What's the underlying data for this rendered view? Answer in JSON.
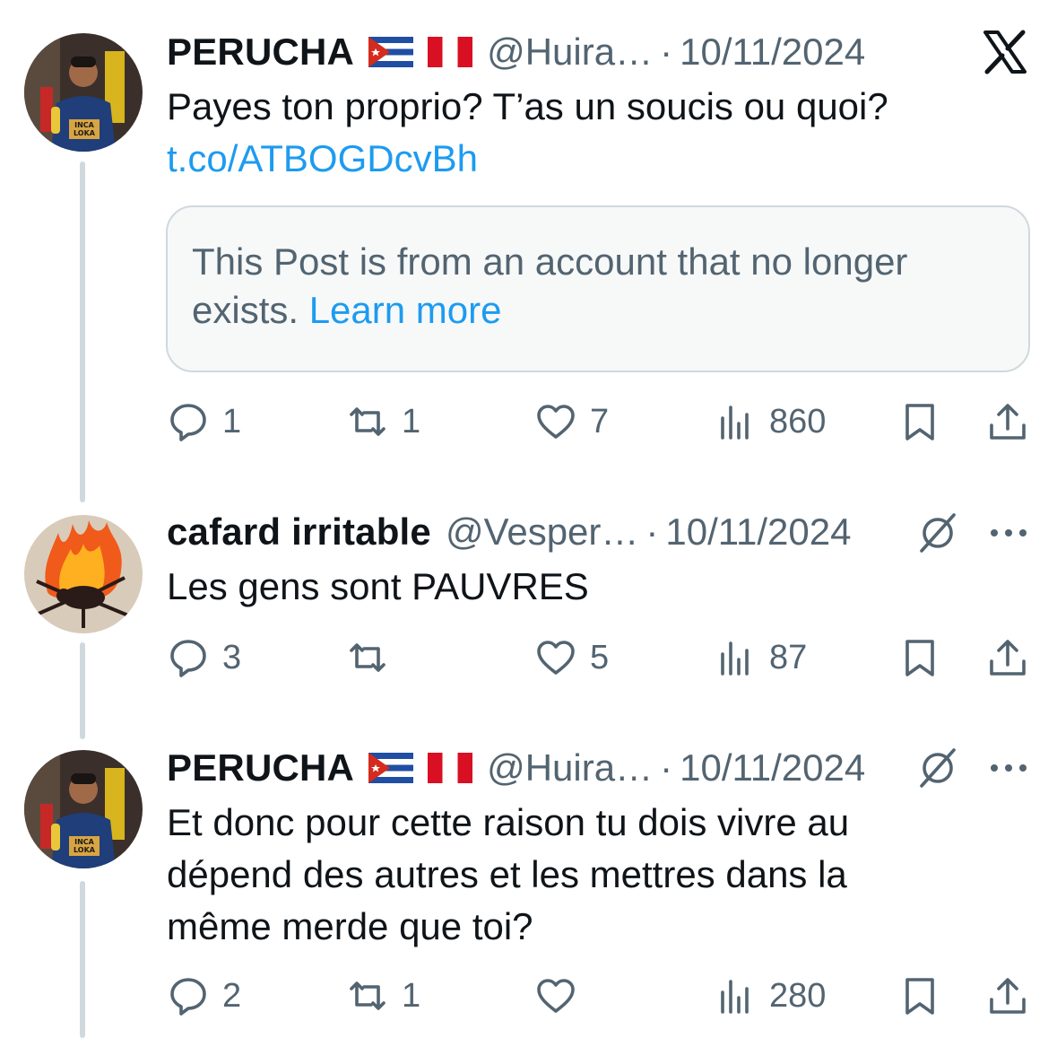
{
  "colors": {
    "text": "#0f1419",
    "secondary": "#536471",
    "link": "#1d9bf0",
    "thread_line": "#cfd9de",
    "card_background": "#f7f9f9"
  },
  "app": {
    "logo_icon": "x-logo-icon"
  },
  "posts": [
    {
      "author_name": "PERUCHA",
      "flags": [
        "cuba-flag-icon",
        "peru-flag-icon"
      ],
      "handle": "@Huira…",
      "separator": "·",
      "date": "10/11/2024",
      "text_lines": [
        "Payes ton proprio? T’as un soucis ou quoi?"
      ],
      "link": "t.co/ATBOGDcvBh",
      "quote": {
        "line1": "This Post is from an account that no longer",
        "line2": "exists.",
        "learn_more": "Learn more"
      },
      "stats": {
        "replies": "1",
        "reposts": "1",
        "likes": "7",
        "views": "860"
      }
    },
    {
      "author_name": "cafard irritable",
      "handle": "@Vesper…",
      "separator": "·",
      "date": "10/11/2024",
      "text_lines": [
        "Les gens sont PAUVRES"
      ],
      "stats": {
        "replies": "3",
        "reposts": "",
        "likes": "5",
        "views": "87"
      }
    },
    {
      "author_name": "PERUCHA",
      "flags": [
        "cuba-flag-icon",
        "peru-flag-icon"
      ],
      "handle": "@Huira…",
      "separator": "·",
      "date": "10/11/2024",
      "text_lines": [
        "Et donc pour cette raison tu dois vivre au",
        "dépend des autres et les mettres dans la",
        "même merde que toi?"
      ],
      "stats": {
        "replies": "2",
        "reposts": "1",
        "likes": "",
        "views": "280"
      }
    }
  ],
  "avatar_badge_text": [
    "INCA",
    "LOKA"
  ]
}
